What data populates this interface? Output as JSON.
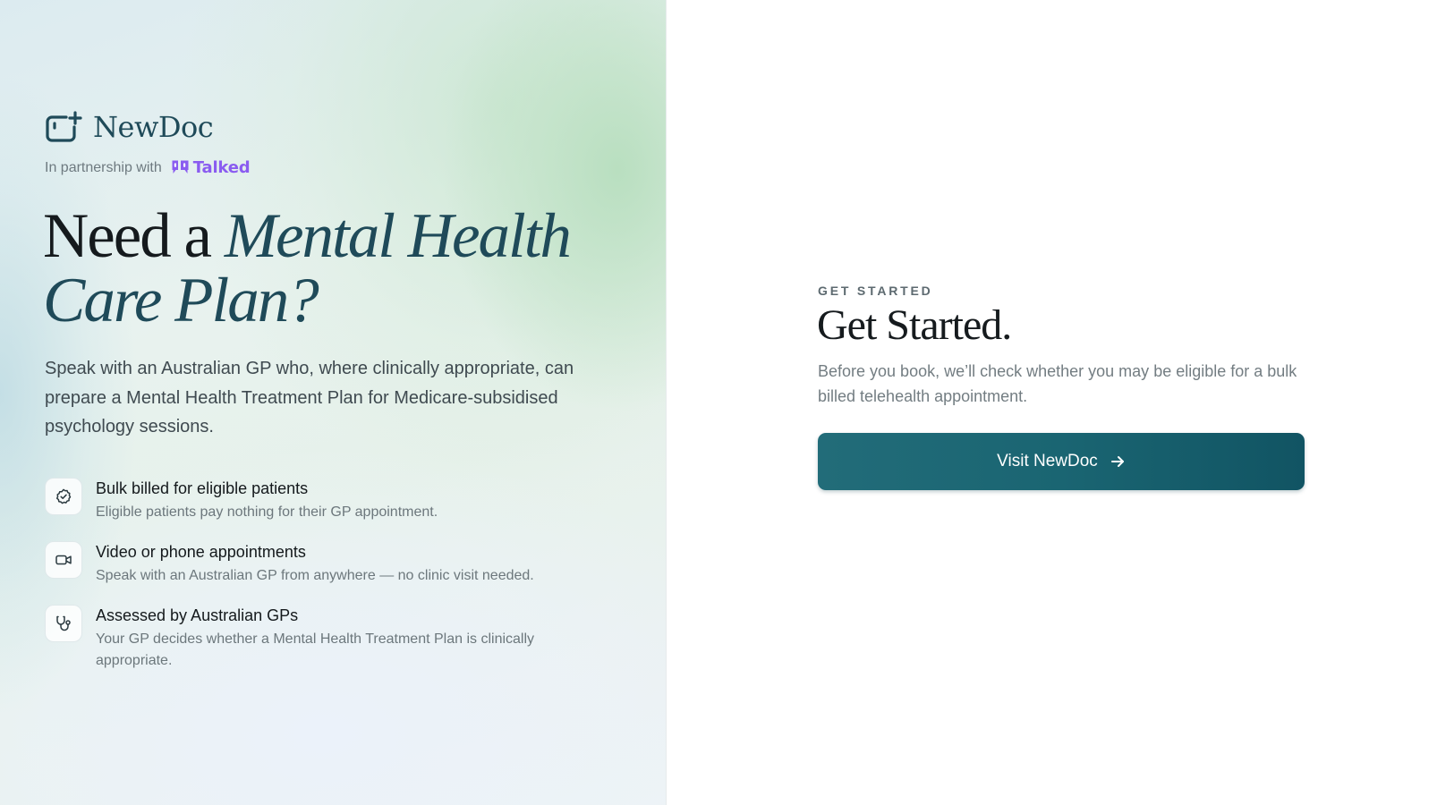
{
  "brand": {
    "name": "NewDoc",
    "partner_text": "In partnership with",
    "partner_name": "Talked",
    "partner_color": "#8a5cf0",
    "logo_icon": "calendar-plus-icon"
  },
  "hero": {
    "headline_plain": "Need a ",
    "headline_accent": "Mental Health Care Plan?",
    "lede": "Speak with an Australian GP who, where clinically appropriate, can prepare a Mental Health Treatment Plan for Medicare-subsidised psychology sessions."
  },
  "features": [
    {
      "icon": "check-badge-icon",
      "title": "Bulk billed for eligible patients",
      "desc": "Eligible patients pay nothing for their GP appointment."
    },
    {
      "icon": "video-camera-icon",
      "title": "Video or phone appointments",
      "desc": "Speak with an Australian GP from anywhere — no clinic visit needed."
    },
    {
      "icon": "stethoscope-icon",
      "title": "Assessed by Australian GPs",
      "desc": "Your GP decides whether a Mental Health Treatment Plan is clinically appropriate."
    }
  ],
  "get_started": {
    "eyebrow": "GET STARTED",
    "title": "Get Started.",
    "subtitle": "Before you book, we’ll check whether you may be eligible for a bulk billed telehealth appointment.",
    "cta_label": "Visit NewDoc",
    "cta_icon": "arrow-right-icon"
  },
  "colors": {
    "accent": "#1f4a59",
    "button": "#1a6572"
  }
}
